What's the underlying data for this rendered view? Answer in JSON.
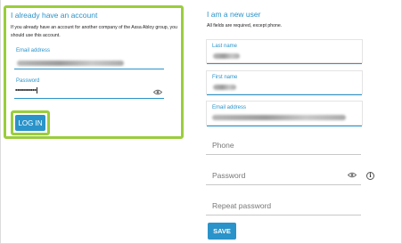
{
  "existing_account": {
    "title": "I already have an account",
    "description": "If you already have an account for another company of the Assa Abloy group, you should use this account.",
    "email_label": "Email address",
    "email_value": "",
    "password_label": "Password",
    "password_value": "••••••••••••",
    "login_label": "LOG IN"
  },
  "new_user": {
    "title": "I am a new user",
    "description": "All fields are required, except phone.",
    "last_name_label": "Last name",
    "first_name_label": "First name",
    "email_label": "Email address",
    "phone_placeholder": "Phone",
    "password_placeholder": "Password",
    "repeat_password_placeholder": "Repeat password",
    "save_label": "SAVE"
  },
  "colors": {
    "accent": "#2a93c9",
    "highlight": "#9acd3c"
  },
  "icons": {
    "password_toggle": "eye-icon",
    "info": "info-icon"
  }
}
